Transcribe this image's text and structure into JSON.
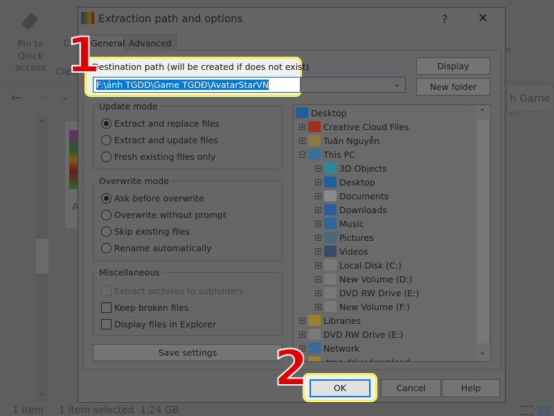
{
  "explorer": {
    "pin_label": "Pin to Quick access",
    "clipboard_label": "Clipb",
    "copy_label": "C",
    "search_text": "h Game ...",
    "ribbon_partial": "n",
    "file_label": "A",
    "status_items": "1 item",
    "status_selected": "1 item selected  1,24 GB"
  },
  "dialog": {
    "title": "Extraction path and options",
    "help": "?",
    "close": "✕",
    "tabs": [
      {
        "label": "General",
        "active": true
      },
      {
        "label": "Advanced",
        "active": false
      }
    ],
    "destination_label": "Destination path (will be created if does not exist)",
    "destination_value": "F:\\ảnh TGDD\\Game TGDĐ\\AvatarStarVN",
    "display_button": "Display",
    "new_folder_button": "New folder",
    "update_mode": {
      "title": "Update mode",
      "options": [
        {
          "label": "Extract and replace files",
          "selected": true
        },
        {
          "label": "Extract and update files",
          "selected": false
        },
        {
          "label": "Fresh existing files only",
          "selected": false
        }
      ]
    },
    "overwrite_mode": {
      "title": "Overwrite mode",
      "options": [
        {
          "label": "Ask before overwrite",
          "selected": true
        },
        {
          "label": "Overwrite without prompt",
          "selected": false
        },
        {
          "label": "Skip existing files",
          "selected": false
        },
        {
          "label": "Rename automatically",
          "selected": false
        }
      ]
    },
    "misc": {
      "title": "Miscellaneous",
      "options": [
        {
          "label": "Extract archives to subfolders",
          "checked": false,
          "disabled": true
        },
        {
          "label": "Keep broken files",
          "checked": false
        },
        {
          "label": "Display files in Explorer",
          "checked": false
        }
      ]
    },
    "save_settings": "Save settings",
    "tree": [
      {
        "label": "Desktop",
        "level": 0,
        "icon": "desktop-icon",
        "color": "#1f5f9e"
      },
      {
        "label": "Creative Cloud Files",
        "level": 1,
        "icon": "creative-cloud-icon",
        "color": "#a03020"
      },
      {
        "label": "Tuấn Nguyễn",
        "level": 1,
        "icon": "user-folder-icon",
        "color": "#8a7a40"
      },
      {
        "label": "This PC",
        "level": 1,
        "icon": "computer-icon",
        "color": "#3a6e9a",
        "expanded": true
      },
      {
        "label": "3D Objects",
        "level": 2,
        "icon": "cube-icon",
        "color": "#2a8a9a"
      },
      {
        "label": "Desktop",
        "level": 2,
        "icon": "desktop-icon",
        "color": "#1f5f9e"
      },
      {
        "label": "Documents",
        "level": 2,
        "icon": "document-icon",
        "color": "#8a8a8a"
      },
      {
        "label": "Downloads",
        "level": 2,
        "icon": "download-icon",
        "color": "#2a5f9a"
      },
      {
        "label": "Music",
        "level": 2,
        "icon": "music-icon",
        "color": "#2a6a9a"
      },
      {
        "label": "Pictures",
        "level": 2,
        "icon": "pictures-icon",
        "color": "#4a6a7a"
      },
      {
        "label": "Videos",
        "level": 2,
        "icon": "videos-icon",
        "color": "#3a4a6a"
      },
      {
        "label": "Local Disk (C:)",
        "level": 2,
        "icon": "disk-icon",
        "color": "#7a7a7a"
      },
      {
        "label": "New Volume (D:)",
        "level": 2,
        "icon": "disk-icon",
        "color": "#7a7a7a"
      },
      {
        "label": "DVD RW Drive (E:)",
        "level": 2,
        "icon": "dvd-icon",
        "color": "#7a7a7a"
      },
      {
        "label": "New Volume (F:)",
        "level": 2,
        "icon": "disk-icon",
        "color": "#7a7a7a"
      },
      {
        "label": "Libraries",
        "level": 1,
        "icon": "libraries-icon",
        "color": "#9a8030"
      },
      {
        "label": "DVD RW Drive (E:)",
        "level": 1,
        "icon": "dvd-icon",
        "color": "#7a7a7a"
      },
      {
        "label": "Network",
        "level": 1,
        "icon": "network-icon",
        "color": "#3a6a9a"
      },
      {
        "label": ".tmp.drivedownload",
        "level": 1,
        "icon": "folder-icon",
        "color": "#9a8030"
      }
    ],
    "ok": "OK",
    "cancel": "Cancel",
    "help_button": "Help"
  },
  "annotations": {
    "step1": "1",
    "step2": "2",
    "highlight_color": "#f4ef2a",
    "marker_color": "#e00000"
  }
}
